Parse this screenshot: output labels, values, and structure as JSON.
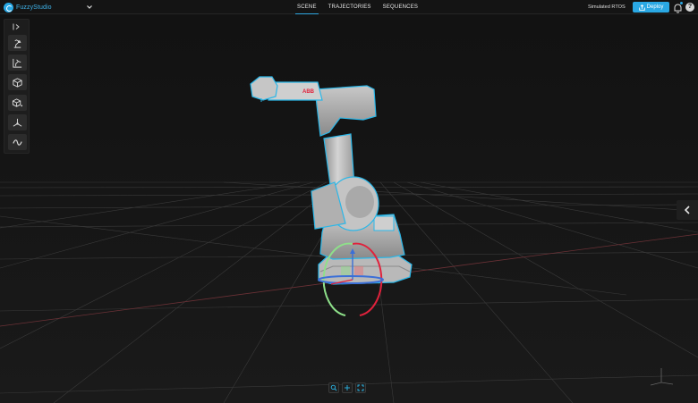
{
  "app": {
    "brand": "FuzzyStudio"
  },
  "nav": {
    "tabs": [
      {
        "label": "SCENE",
        "active": true
      },
      {
        "label": "TRAJECTORIES",
        "active": false
      },
      {
        "label": "SEQUENCES",
        "active": false
      }
    ]
  },
  "header": {
    "runtime": "Simulated RTOS",
    "deploy_label": "Deploy",
    "help_label": "?"
  },
  "toolbar": {
    "tools": [
      {
        "icon": "robot-arm-icon"
      },
      {
        "icon": "robot-scene-icon"
      },
      {
        "icon": "cube-icon"
      },
      {
        "icon": "cube-plus-icon"
      },
      {
        "icon": "frame-axes-icon"
      },
      {
        "icon": "wave-path-icon"
      }
    ]
  },
  "robot": {
    "brand_marking": "ABB"
  },
  "colors": {
    "accent": "#2aa8e4",
    "selection_outline": "#2bb7e8",
    "gizmo_red": "#e0223c",
    "gizmo_green": "#8ee08a",
    "gizmo_blue": "#3b6fd8",
    "grid": "#3a3a3a",
    "background": "#141414"
  },
  "viewport_controls": [
    {
      "icon": "zoom-fit-icon"
    },
    {
      "icon": "add-icon"
    },
    {
      "icon": "expand-icon"
    }
  ]
}
